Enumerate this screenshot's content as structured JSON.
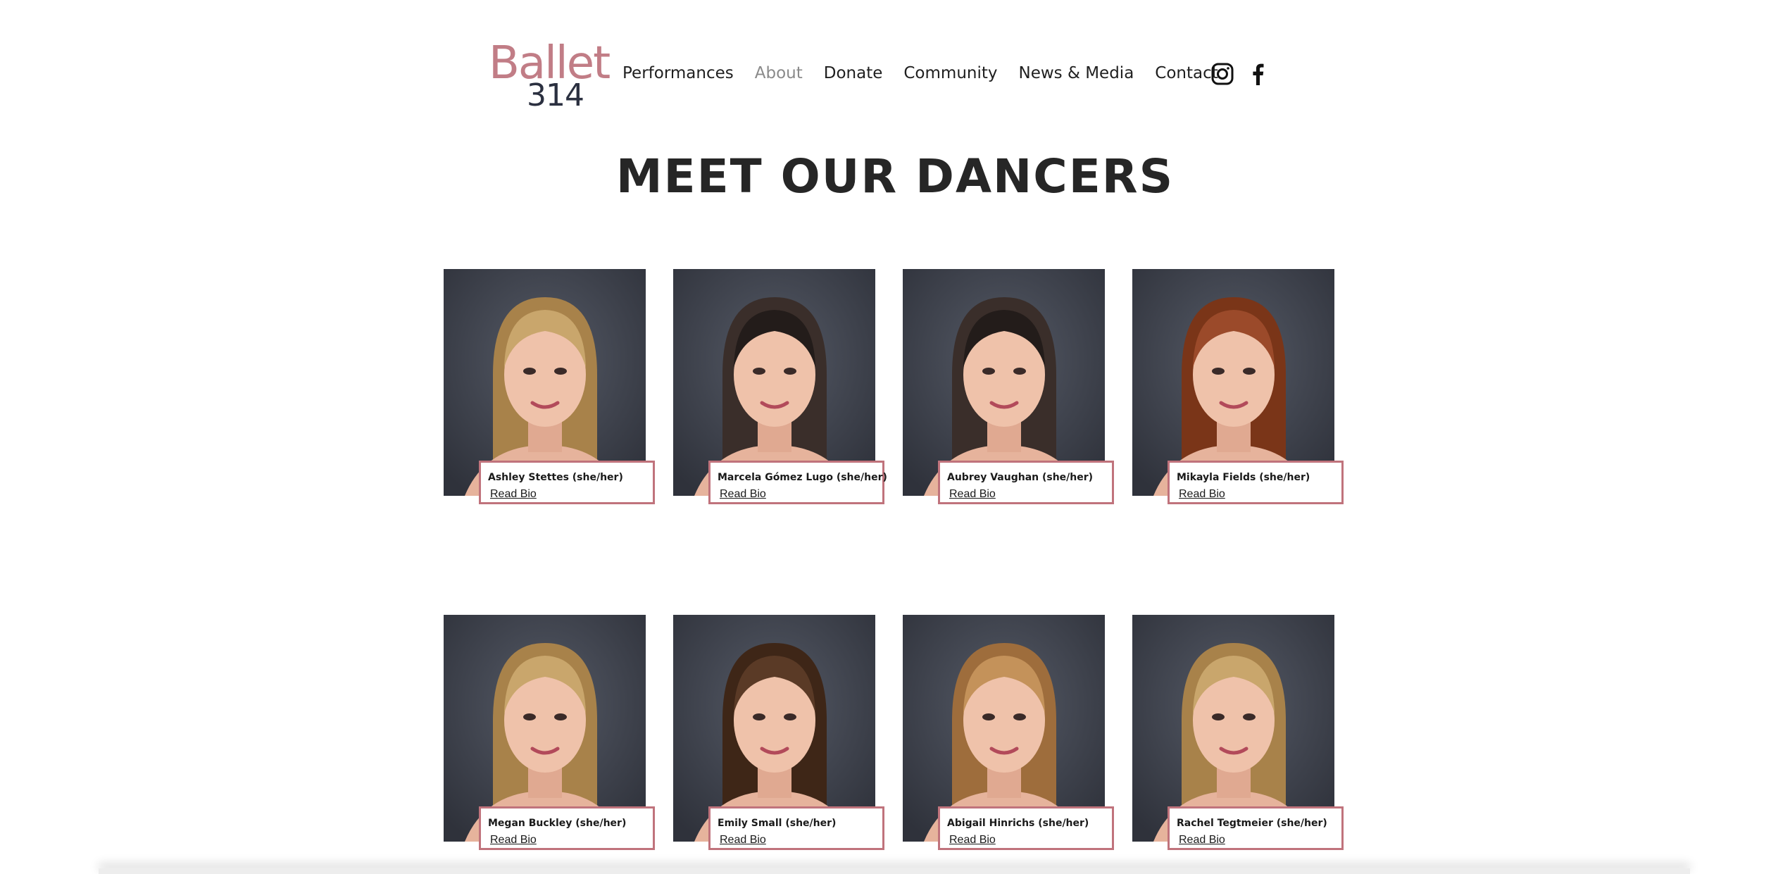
{
  "brand": {
    "logo_top": "Ballet",
    "logo_bottom": "314",
    "logo_color": "#c17d86",
    "logo_dark": "#2b3040"
  },
  "nav": {
    "items": [
      {
        "label": "Performances"
      },
      {
        "label": "About",
        "active": true
      },
      {
        "label": "Donate"
      },
      {
        "label": "Community"
      },
      {
        "label": "News & Media"
      },
      {
        "label": "Contact"
      }
    ],
    "active_color": "#8a8a8a",
    "social": [
      "instagram-icon",
      "facebook-icon"
    ]
  },
  "main": {
    "title": "MEET OUR DANCERS",
    "accent": "#c0737c",
    "dancers": [
      {
        "name": "Ashley Stettes (she/her)",
        "link": "Read Bio",
        "hair": "blonde"
      },
      {
        "name": "Marcela Gómez Lugo (she/her)",
        "link": "Read Bio",
        "hair": "dark"
      },
      {
        "name": "Aubrey Vaughan (she/her)",
        "link": "Read Bio",
        "hair": "dark"
      },
      {
        "name": "Mikayla Fields (she/her)",
        "link": "Read Bio",
        "hair": "red"
      },
      {
        "name": "Megan Buckley (she/her)",
        "link": "Read Bio",
        "hair": "blonde"
      },
      {
        "name": "Emily Small (she/her)",
        "link": "Read Bio",
        "hair": "brown"
      },
      {
        "name": "Abigail Hinrichs (she/her)",
        "link": "Read Bio",
        "hair": "strawberry"
      },
      {
        "name": "Rachel Tegtmeier (she/her)",
        "link": "Read Bio",
        "hair": "blonde"
      }
    ]
  }
}
